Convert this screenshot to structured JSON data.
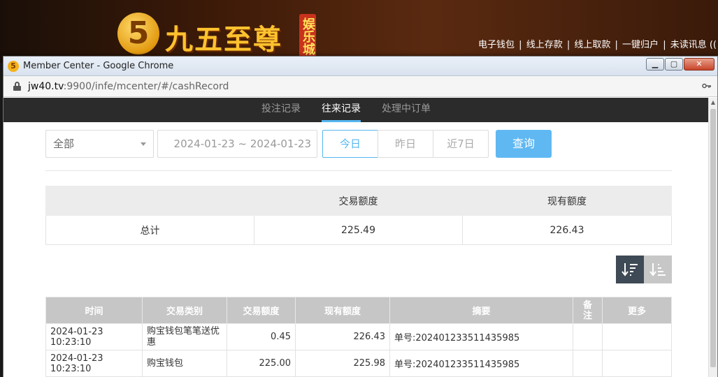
{
  "background_site": {
    "logo_digit": "5",
    "logo_name": "九五至尊",
    "logo_tag": "娱乐城",
    "topnav": [
      "电子钱包",
      "线上存款",
      "线上取款",
      "一键归户",
      "未读讯息 (("
    ]
  },
  "window": {
    "title": "Member Center - Google Chrome",
    "controls": {
      "minimize": "▁",
      "maximize": "▢",
      "close": "✕"
    }
  },
  "address": {
    "host": "jw40.tv",
    "path": ":9900/infe/mcenter/#/cashRecord"
  },
  "subnav": {
    "tabs": [
      {
        "label": "投注记录",
        "active": false
      },
      {
        "label": "往来记录",
        "active": true
      },
      {
        "label": "处理中订单",
        "active": false
      }
    ]
  },
  "filters": {
    "type_select": "全部",
    "date_range": "2024-01-23 ~ 2024-01-23",
    "quick": [
      "今日",
      "昨日",
      "近7日"
    ],
    "query_label": "查询"
  },
  "summary": {
    "headers": [
      "",
      "交易额度",
      "现有额度"
    ],
    "row": [
      "总计",
      "225.49",
      "226.43"
    ]
  },
  "records": {
    "headers": [
      "时间",
      "交易类别",
      "交易额度",
      "现有额度",
      "摘要",
      "备注",
      "更多"
    ],
    "rows": [
      [
        "2024-01-23 10:23:10",
        "购宝钱包笔笔送优惠",
        "0.45",
        "226.43",
        "单号:202401233511435985",
        "",
        ""
      ],
      [
        "2024-01-23 10:23:10",
        "购宝钱包",
        "225.00",
        "225.98",
        "单号:202401233511435985",
        "",
        ""
      ]
    ]
  },
  "colors": {
    "accent": "#56b6f0",
    "subnav_bg": "#2b2b2b",
    "table_header_bg": "#c6c6c6"
  }
}
